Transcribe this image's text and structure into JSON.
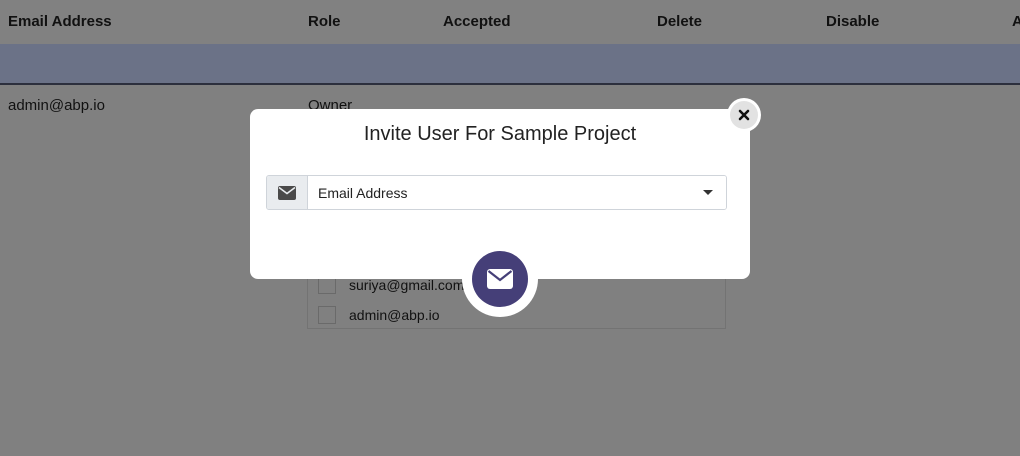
{
  "table": {
    "headers": [
      "Email Address",
      "Role",
      "Accepted",
      "Delete",
      "Disable",
      "A"
    ],
    "rows": [
      {
        "email": "admin@abp.io",
        "role": "Owner"
      }
    ]
  },
  "dropdown": {
    "items": [
      {
        "label": "suriya@gmail.com",
        "checked": false
      },
      {
        "label": "admin@abp.io",
        "checked": false
      }
    ]
  },
  "modal": {
    "title": "Invite User For Sample Project",
    "email_select_label": "Email Address",
    "close_icon": "close-icon",
    "send_icon": "envelope-icon"
  },
  "colors": {
    "accent": "#453f78",
    "overlay": "#808080",
    "header_band": "#6b7287"
  }
}
